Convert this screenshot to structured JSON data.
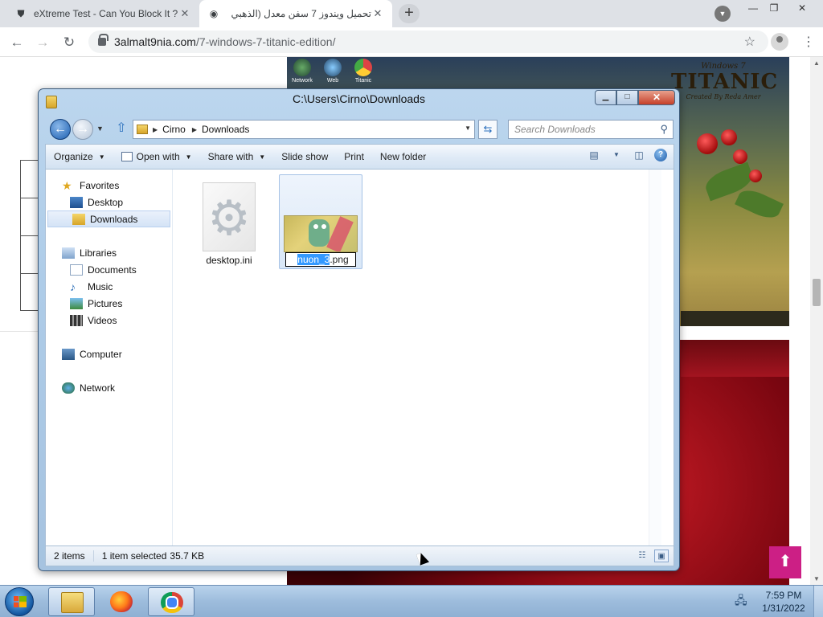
{
  "browser": {
    "tabs": [
      {
        "title": "eXtreme Test - Can You Block It ?",
        "icon": "shield-icon"
      },
      {
        "title": "تحميل ويندوز 7 سفن معدل (الذهبي",
        "icon": "user-avatar-icon"
      }
    ],
    "url_host": "3almalt9nia.com",
    "url_path": "/7-windows-7-titanic-edition/",
    "new_tab_symbol": "+",
    "close_symbol": "✕"
  },
  "page": {
    "desktop_icons": [
      "Network",
      "Web",
      "Titanic"
    ],
    "banner_small": "Windows 7",
    "banner_big": "TITANIC",
    "banner_tag": "Created By Reda Amer",
    "accent": "#cc1f85"
  },
  "explorer": {
    "title": "C:\\Users\\Cirno\\Downloads",
    "breadcrumb": [
      "Cirno",
      "Downloads"
    ],
    "search_placeholder": "Search Downloads",
    "commands": [
      {
        "label": "Organize",
        "has_dropdown": true
      },
      {
        "label": "Open with",
        "has_dropdown": true
      },
      {
        "label": "Share with",
        "has_dropdown": true
      },
      {
        "label": "Slide show",
        "has_dropdown": false
      },
      {
        "label": "Print",
        "has_dropdown": false
      },
      {
        "label": "New folder",
        "has_dropdown": false
      }
    ],
    "nav": {
      "favorites": "Favorites",
      "desktop": "Desktop",
      "downloads": "Downloads",
      "libraries": "Libraries",
      "documents": "Documents",
      "music": "Music",
      "pictures": "Pictures",
      "videos": "Videos",
      "computer": "Computer",
      "network": "Network"
    },
    "files": [
      {
        "name": "desktop.ini",
        "type": "settings-file"
      },
      {
        "name_selected": "nuon_3",
        "name_rest": ".png",
        "type": "png-image",
        "renaming": true
      }
    ],
    "status": {
      "items": "2 items",
      "selected": "1 item selected",
      "size": "35.7 KB"
    }
  },
  "taskbar": {
    "apps": [
      "windows-explorer",
      "firefox",
      "chrome"
    ],
    "time": "7:59 PM",
    "date": "1/31/2022"
  }
}
